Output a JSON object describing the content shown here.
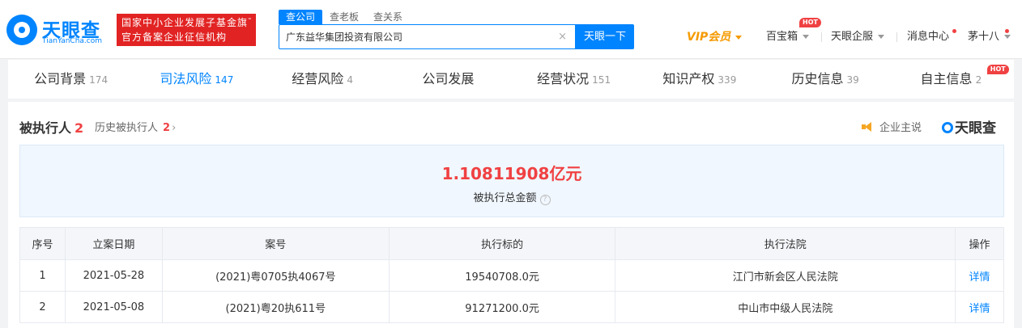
{
  "header": {
    "logo": {
      "name": "天眼查",
      "sub": "TianYanCha.com"
    },
    "slogan": {
      "line1": "国家中小企业发展子基金旗下",
      "line2": "官方备案企业征信机构"
    },
    "search_tabs": [
      "查公司",
      "查老板",
      "查关系"
    ],
    "search": {
      "value": "广东益华集团投资有限公司",
      "clear": "×",
      "button": "天眼一下"
    },
    "nav": {
      "vip": "VIP会员",
      "treasure": "百宝箱",
      "hot": "HOT",
      "enterprise": "天眼企服",
      "messages": "消息中心",
      "user": "茅十八"
    }
  },
  "tabs": [
    {
      "label": "公司背景",
      "count": "174"
    },
    {
      "label": "司法风险",
      "count": "147"
    },
    {
      "label": "经营风险",
      "count": "4"
    },
    {
      "label": "公司发展",
      "count": ""
    },
    {
      "label": "经营状况",
      "count": "151"
    },
    {
      "label": "知识产权",
      "count": "339"
    },
    {
      "label": "历史信息",
      "count": "39"
    },
    {
      "label": "自主信息",
      "count": "2",
      "badge": "HOT"
    }
  ],
  "section": {
    "title": "被执行人",
    "count": "2",
    "history_label": "历史被执行人",
    "history_count": "2",
    "history_chevron": "›",
    "ad_label": "企业主说",
    "brand": "天眼查"
  },
  "summary": {
    "amount": "1.10811908亿元",
    "label": "被执行总金额",
    "help": "?"
  },
  "table": {
    "headers": [
      "序号",
      "立案日期",
      "案号",
      "执行标的",
      "执行法院",
      "操作"
    ],
    "rows": [
      [
        "1",
        "2021-05-28",
        "(2021)粤0705执4067号",
        "19540708.0元",
        "江门市新会区人民法院",
        "详情"
      ],
      [
        "2",
        "2021-05-08",
        "(2021)粤20执611号",
        "91271200.0元",
        "中山市中级人民法院",
        "详情"
      ]
    ]
  },
  "colors": {
    "brand_blue": "#0084ff",
    "danger_red": "#f04142",
    "slogan_red": "#e22323",
    "vip_orange": "#f59a00"
  }
}
